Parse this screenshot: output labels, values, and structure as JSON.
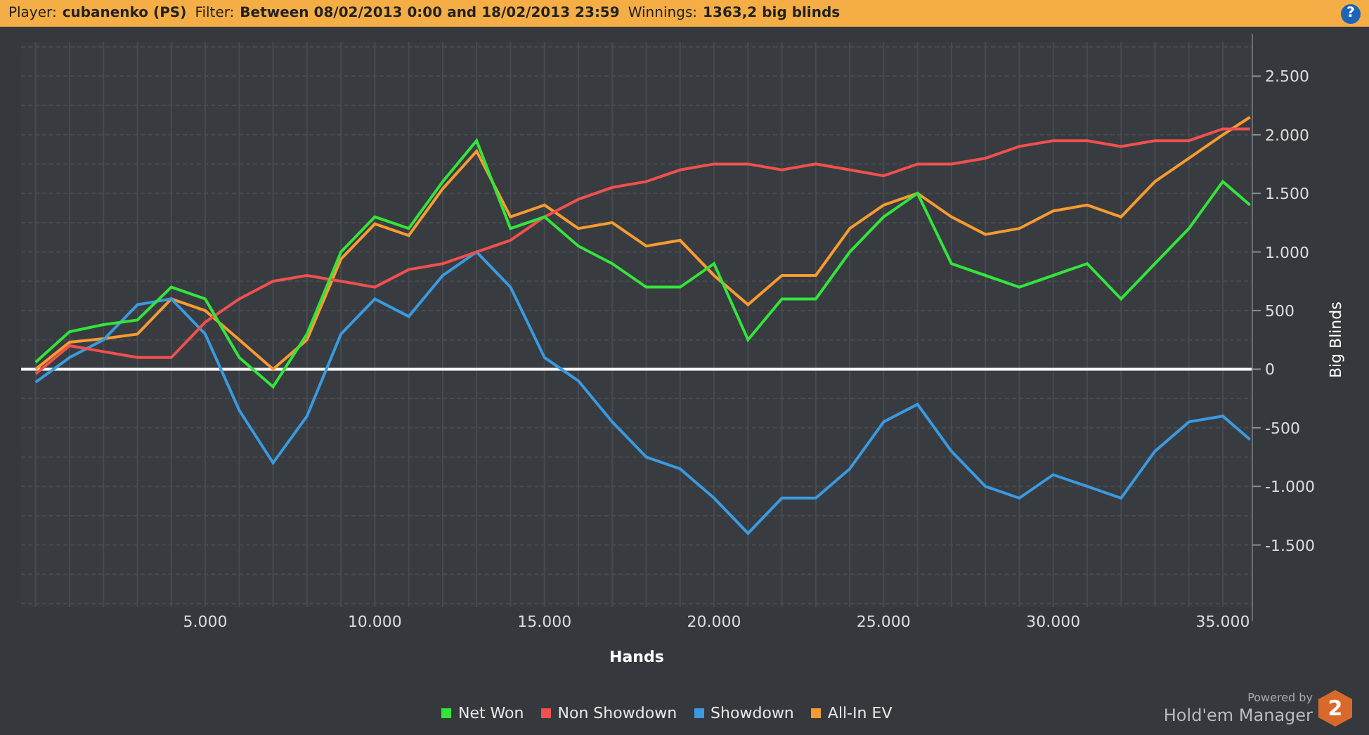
{
  "header": {
    "fields": [
      {
        "label": "Player:",
        "value": "cubanenko (PS)"
      },
      {
        "label": "Filter:",
        "value": "Between 08/02/2013 0:00 and 18/02/2013 23:59"
      },
      {
        "label": "Winnings:",
        "value": "1363,2 big blinds"
      }
    ],
    "help": "?"
  },
  "chart": {
    "chart_data": {
      "type": "line",
      "xlabel": "Hands",
      "ylabel": "Big Blinds",
      "x": [
        0,
        1000,
        2000,
        3000,
        4000,
        5000,
        6000,
        7000,
        8000,
        9000,
        10000,
        11000,
        12000,
        13000,
        14000,
        15000,
        16000,
        17000,
        18000,
        19000,
        20000,
        21000,
        22000,
        23000,
        24000,
        25000,
        26000,
        27000,
        28000,
        29000,
        30000,
        31000,
        32000,
        33000,
        34000,
        35000,
        35800
      ],
      "series": [
        {
          "name": "Net Won",
          "color": "#33e53a",
          "values": [
            60,
            320,
            380,
            420,
            700,
            600,
            100,
            -150,
            300,
            1000,
            1300,
            1200,
            1600,
            1950,
            1200,
            1300,
            1050,
            900,
            700,
            700,
            900,
            250,
            600,
            600,
            1000,
            1300,
            1500,
            900,
            800,
            700,
            800,
            900,
            600,
            900,
            1200,
            1600,
            1400
          ]
        },
        {
          "name": "Non Showdown",
          "color": "#f0504f",
          "values": [
            -40,
            200,
            150,
            100,
            100,
            400,
            600,
            750,
            800,
            750,
            700,
            850,
            900,
            1000,
            1100,
            1300,
            1450,
            1550,
            1600,
            1700,
            1750,
            1750,
            1700,
            1750,
            1700,
            1650,
            1750,
            1750,
            1800,
            1900,
            1950,
            1950,
            1900,
            1950,
            1950,
            2050,
            2050
          ]
        },
        {
          "name": "Showdown",
          "color": "#3a9ae0",
          "values": [
            -110,
            100,
            250,
            550,
            600,
            300,
            -350,
            -800,
            -400,
            300,
            600,
            450,
            800,
            1000,
            700,
            100,
            -100,
            -450,
            -750,
            -850,
            -1100,
            -1400,
            -1100,
            -1100,
            -850,
            -450,
            -300,
            -700,
            -1000,
            -1100,
            -900,
            -1000,
            -1100,
            -700,
            -450,
            -400,
            -600
          ]
        },
        {
          "name": "All-In EV",
          "color": "#f89b30",
          "values": [
            0,
            230,
            260,
            300,
            600,
            500,
            250,
            0,
            250,
            940,
            1240,
            1140,
            1540,
            1860,
            1300,
            1400,
            1200,
            1250,
            1050,
            1100,
            800,
            550,
            800,
            800,
            1200,
            1400,
            1500,
            1300,
            1150,
            1200,
            1350,
            1400,
            1300,
            1600,
            1800,
            2000,
            2150
          ]
        }
      ],
      "grid": true,
      "xlim": [
        -430,
        35870
      ],
      "ylim": [
        -2030,
        2790
      ],
      "xticks": [
        {
          "value": 5000,
          "label": "5.000"
        },
        {
          "value": 10000,
          "label": "10.000"
        },
        {
          "value": 15000,
          "label": "15.000"
        },
        {
          "value": 20000,
          "label": "20.000"
        },
        {
          "value": 25000,
          "label": "25.000"
        },
        {
          "value": 30000,
          "label": "30.000"
        },
        {
          "value": 35000,
          "label": "35.000"
        }
      ],
      "yticks": [
        {
          "value": 2500,
          "label": "2.500"
        },
        {
          "value": 2000,
          "label": "2.000"
        },
        {
          "value": 1500,
          "label": "1.500"
        },
        {
          "value": 1000,
          "label": "1.000"
        },
        {
          "value": 500,
          "label": "500"
        },
        {
          "value": 0,
          "label": "0"
        },
        {
          "value": -500,
          "label": "-500"
        },
        {
          "value": -1000,
          "label": "-1.000"
        },
        {
          "value": -1500,
          "label": "-1.500"
        }
      ]
    }
  },
  "branding": {
    "powered_by": "Powered by",
    "product": "Hold'em Manager",
    "version": "2"
  }
}
